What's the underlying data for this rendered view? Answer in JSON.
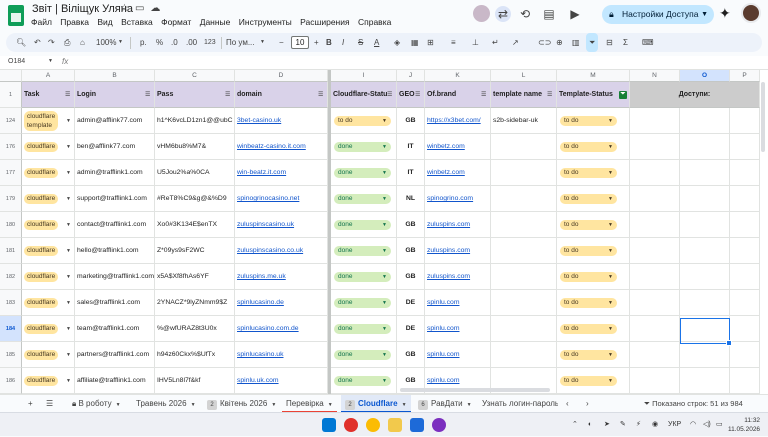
{
  "titlebar": {
    "doc_title": "Звіт | Віліщук Уляна",
    "menu": [
      "Файл",
      "Правка",
      "Вид",
      "Вставка",
      "Формат",
      "Данные",
      "Инструменты",
      "Расширения",
      "Справка"
    ],
    "share_label": "Настройки Доступа"
  },
  "toolbar": {
    "zoom": "100%",
    "currency": "р.",
    "percent": "%",
    "dec_less": ".0",
    "dec_more": ".00",
    "num_format": "123",
    "font_name": "По ум...",
    "font_size": "10",
    "bold": "B",
    "italic": "I",
    "strike": "S",
    "text_color": "A"
  },
  "formula_bar": {
    "name_box": "O184",
    "fx": "fx",
    "value": ""
  },
  "grid": {
    "columns": [
      "A",
      "B",
      "C",
      "D",
      "",
      "I",
      "J",
      "K",
      "L",
      "M",
      "N",
      "O",
      "P"
    ],
    "headers": {
      "task": "Task",
      "login": "Login",
      "pass": "Pass",
      "domain": "domain",
      "cf_status": "Cloudflare-Statu",
      "geo": "GEO",
      "brand": "Of.brand",
      "template_name": "template name",
      "template_status": "Template-Status",
      "dostupy": "Доступи:"
    },
    "header_rownum": "1",
    "rows": [
      {
        "num": "124",
        "task": "cloudflare template",
        "login": "admin@afflink77.com",
        "pass": "h1^K6vcLD1zn1@@ubC",
        "domain": "3bet-casino.uk",
        "cf": "to do",
        "geo": "GB",
        "brand": "https://x3bet.com/",
        "tname": "s2b-sidebar-uk",
        "tstatus": "to do"
      },
      {
        "num": "176",
        "task": "cloudflare",
        "login": "ben@afflink77.com",
        "pass": "vHM6bu8%M7&",
        "domain": "winbeatz-casino.it.com",
        "cf": "done",
        "geo": "IT",
        "brand": "winbetz.com",
        "tname": "",
        "tstatus": "to do"
      },
      {
        "num": "177",
        "task": "cloudflare",
        "login": "admin@trafflink1.com",
        "pass": "U5Jou2%a%0CA",
        "domain": "win-beatz.it.com",
        "cf": "done",
        "geo": "IT",
        "brand": "winbetz.com",
        "tname": "",
        "tstatus": "to do"
      },
      {
        "num": "179",
        "task": "cloudflare",
        "login": "support@trafflink1.com",
        "pass": "#ReT8%C9&g@&%D9",
        "domain": "spinogrinocasino.net",
        "cf": "done",
        "geo": "NL",
        "brand": "spinogrino.com",
        "tname": "",
        "tstatus": "to do"
      },
      {
        "num": "180",
        "task": "cloudflare",
        "login": "contact@trafflink1.com",
        "pass": "Xo0#3K134E$enTX",
        "domain": "zuluspinscasino.uk",
        "cf": "done",
        "geo": "GB",
        "brand": "zuluspins.com",
        "tname": "",
        "tstatus": "to do"
      },
      {
        "num": "181",
        "task": "cloudflare",
        "login": "hello@trafflink1.com",
        "pass": "Z*09ys9sF2WC",
        "domain": "zuluspinscasino.co.uk",
        "cf": "done",
        "geo": "GB",
        "brand": "zuluspins.com",
        "tname": "",
        "tstatus": "to do"
      },
      {
        "num": "182",
        "task": "cloudflare",
        "login": "marketing@trafflink1.com",
        "pass": "x5A$Xf8fhAs6YF",
        "domain": "zuluspins.me.uk",
        "cf": "done",
        "geo": "GB",
        "brand": "zuluspins.com",
        "tname": "",
        "tstatus": "to do"
      },
      {
        "num": "183",
        "task": "cloudflare",
        "login": "sales@trafflink1.com",
        "pass": "2YNACZ*9lyZNmm9$Z",
        "domain": "spinlucasino.de",
        "cf": "done",
        "geo": "DE",
        "brand": "spinlu.com",
        "tname": "",
        "tstatus": "to do"
      },
      {
        "num": "184",
        "task": "cloudflare",
        "login": "team@trafflink1.com",
        "pass": "%@wfURAZ8t3U0x",
        "domain": "spinlucasino.com.de",
        "cf": "done",
        "geo": "DE",
        "brand": "spinlu.com",
        "tname": "",
        "tstatus": "to do"
      },
      {
        "num": "185",
        "task": "cloudflare",
        "login": "partners@trafflink1.com",
        "pass": "h94z60Ckx%$UfTx",
        "domain": "spinlucasino.uk",
        "cf": "done",
        "geo": "GB",
        "brand": "spinlu.com",
        "tname": "",
        "tstatus": "to do"
      },
      {
        "num": "186",
        "task": "cloudflare",
        "login": "affiliate@trafflink1.com",
        "pass": "IHV5Ln8l7f&kf",
        "domain": "spinlu.uk.com",
        "cf": "done",
        "geo": "GB",
        "brand": "spinlu.com",
        "tname": "",
        "tstatus": "to do"
      }
    ]
  },
  "sheet_tabs": [
    {
      "label": "В роботу",
      "prefix": "lock"
    },
    {
      "label": "Травень 2026",
      "prefix": ""
    },
    {
      "label": "Квітень 2026",
      "prefix": "2"
    },
    {
      "label": "Перевірка",
      "prefix": ""
    },
    {
      "label": "Cloudflare",
      "prefix": "2"
    },
    {
      "label": "РавДати",
      "prefix": "6"
    },
    {
      "label": "Узнать логин-пароль",
      "prefix": ""
    }
  ],
  "rows_shown": "Показано строк: 51 из 984",
  "taskbar": {
    "lang": "УКР",
    "time": "11:32",
    "date": "11.05.2026"
  },
  "colors": {
    "todo_chip": "#ffe5a0",
    "done_chip": "#d4edbc",
    "header_purple": "#d9d2e9",
    "accent": "#0b57d0"
  }
}
